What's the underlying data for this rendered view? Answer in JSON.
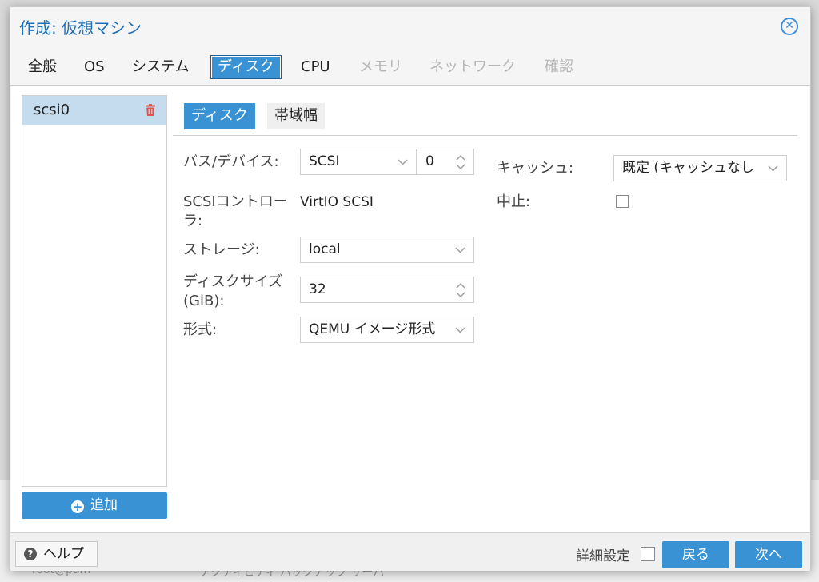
{
  "background": {
    "left_text": "root@pam",
    "right_text": "アクティビティ バックアップ サーバ"
  },
  "dialog": {
    "title": "作成: 仮想マシン",
    "close_icon": "close-circle-icon"
  },
  "tabs": [
    {
      "label": "全般",
      "state": "normal"
    },
    {
      "label": "OS",
      "state": "normal"
    },
    {
      "label": "システム",
      "state": "normal"
    },
    {
      "label": "ディスク",
      "state": "active"
    },
    {
      "label": "CPU",
      "state": "normal"
    },
    {
      "label": "メモリ",
      "state": "disabled"
    },
    {
      "label": "ネットワーク",
      "state": "disabled"
    },
    {
      "label": "確認",
      "state": "disabled"
    }
  ],
  "sidebar": {
    "items": [
      {
        "label": "scsi0",
        "delete_icon": "trash-icon"
      }
    ],
    "add_label": "追加"
  },
  "subtabs": [
    {
      "label": "ディスク",
      "active": true
    },
    {
      "label": "帯域幅",
      "active": false
    }
  ],
  "form": {
    "bus_label": "バス/デバイス:",
    "bus_value": "SCSI",
    "device_value": "0",
    "controller_label_line1": "SCSIコントロー",
    "controller_label_line2": "ラ:",
    "controller_value": "VirtIO SCSI",
    "storage_label": "ストレージ:",
    "storage_value": "local",
    "size_label_line1": "ディスクサイズ",
    "size_label_line2": "(GiB):",
    "size_value": "32",
    "format_label": "形式:",
    "format_value": "QEMU イメージ形式",
    "cache_label": "キャッシュ:",
    "cache_value": "既定 (キャッシュなし",
    "discard_label": "中止:",
    "discard_checked": false
  },
  "footer": {
    "help_label": "ヘルプ",
    "advanced_label": "詳細設定",
    "advanced_checked": false,
    "back_label": "戻る",
    "next_label": "次へ"
  },
  "colors": {
    "accent": "#3892d4",
    "title": "#1e6fb8",
    "delete": "#e0554d",
    "selected_row": "#c5dbee"
  }
}
